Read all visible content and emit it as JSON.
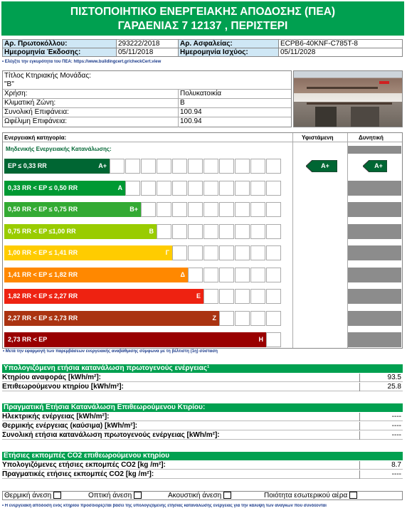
{
  "header": {
    "line1": "ΠΙΣΤΟΠΟΙΗΤΙΚΟ ΕΝΕΡΓΕΙΑΚΗΣ ΑΠΟΔΟΣΗΣ (ΠΕΑ)",
    "line2": "ΓΑΡΔΕΝΙΑΣ 7 12137 , ΠΕΡΙΣΤΕΡΙ"
  },
  "meta": {
    "protocol_label": "Αρ. Πρωτοκόλλου:",
    "protocol_value": "293222/2018",
    "insurance_label": "Αρ. Ασφαλείας:",
    "insurance_value": "ECPB6-40KNF-C785T-8",
    "issue_label": "Ημερομηνία Έκδοσης:",
    "issue_value": "05/11/2018",
    "valid_label": "Ημερομηνία Ισχύος:",
    "valid_value": "05/11/2028",
    "check_note": "• Ελέγξτε την εγκυρότητα του ΠΕΑ: https://www.buildingcert.gr/checkCert.view"
  },
  "building": {
    "title_label": "Τίτλος Κτηριακής Μονάδας:",
    "title_value": "\"Β\"",
    "use_label": "Χρήση:",
    "use_value": "Πολυκατοικία",
    "zone_label": "Κλιματική Ζώνη:",
    "zone_value": "Β",
    "total_label": "Συνολική Επιφάνεια:",
    "total_value": "100.94",
    "useful_label": "Ωφέλιμη Επιφάνεια:",
    "useful_value": "100.94"
  },
  "scale": {
    "category_label": "Ενεργειακή κατηγορία:",
    "existing_label": "Υφιστάμενη",
    "potential_label": "Δυνητική",
    "nzeb_label": "Μηδενικής Ενεργειακής Κατανάλωσης:",
    "existing_rating": "A+",
    "potential_rating": "A+",
    "bars": [
      {
        "label": "EP ≤ 0,33 RR",
        "letter": "A+",
        "color": "#006633"
      },
      {
        "label": "0,33 RR < EP ≤ 0,50 RR",
        "letter": "A",
        "color": "#009933"
      },
      {
        "label": "0,50 RR < EP ≤ 0,75 RR",
        "letter": "B+",
        "color": "#33aa33"
      },
      {
        "label": "0,75 RR < EP ≤1,00 RR",
        "letter": "B",
        "color": "#99cc00"
      },
      {
        "label": "1,00 RR < EP ≤ 1,41 RR",
        "letter": "Γ",
        "color": "#ffcc00"
      },
      {
        "label": "1,41 RR < EP ≤ 1,82 RR",
        "letter": "Δ",
        "color": "#ff8800"
      },
      {
        "label": "1,82 RR < EP ≤ 2,27 RR",
        "letter": "Ε",
        "color": "#ee2211"
      },
      {
        "label": "2,27 RR < EP ≤ 2,73 RR",
        "letter": "Ζ",
        "color": "#aa3311"
      },
      {
        "label": "2,73 RR < EP",
        "letter": "Η",
        "color": "#990000"
      }
    ],
    "footnote": "• Μετά την εφαρμογή των παρεμβάσεων ενεργειακής αναβάθμισης σύμφωνα με τη βέλτιστη (1η) σύσταση"
  },
  "primary": {
    "head": "Υπολογιζόμενη ετήσια κατανάλωση πρωτογενούς ενέργειας¹",
    "ref_label": "Κτηρίου αναφοράς [kWh/m²]:",
    "ref_value": "93.5",
    "insp_label": "Επιθεωρούμενου κτηρίου [kWh/m²]:",
    "insp_value": "25.8"
  },
  "actual": {
    "head": "Πραγματική Ετήσια Κατανάλωση Επιθεωρούμενου Κτιρίου:",
    "elec_label": "Ηλεκτρικής ενέργειας [kWh/m²]:",
    "elec_value": "----",
    "therm_label": "Θερμικής ενέργειας (καύσιμα) [kWh/m²]:",
    "therm_value": "----",
    "total_label": "Συνολική ετήσια κατανάλωση πρωτογενούς ενέργειας [kWh/m²]:",
    "total_value": "----"
  },
  "co2": {
    "head": "Ετήσιες εκπομπές CO2 επιθεωρούμενου κτηρίου",
    "calc_label": "Υπολογιζόμενες ετήσιες εκπομπές CO2 [kg /m²]:",
    "calc_value": "8.7",
    "actual_label": "Πραγματικές ετήσιες εκπομπές CO2 [kg /m²]:",
    "actual_value": "----"
  },
  "comfort": {
    "thermal": "Θερμική άνεση",
    "visual": "Οπτική άνεση",
    "acoustic": "Ακουστική άνεση",
    "air": "Ποιότητα εσωτερικού αέρα"
  },
  "bottom_note": "• Η ενεργειακή απόδοση ενός κτηρίου προσδιορίζεται βάσει της υπολογιζόμενης ετήσιας κατανάλωσης ενέργειας για την κάλυψη των αναγκών που συνδέονται"
}
